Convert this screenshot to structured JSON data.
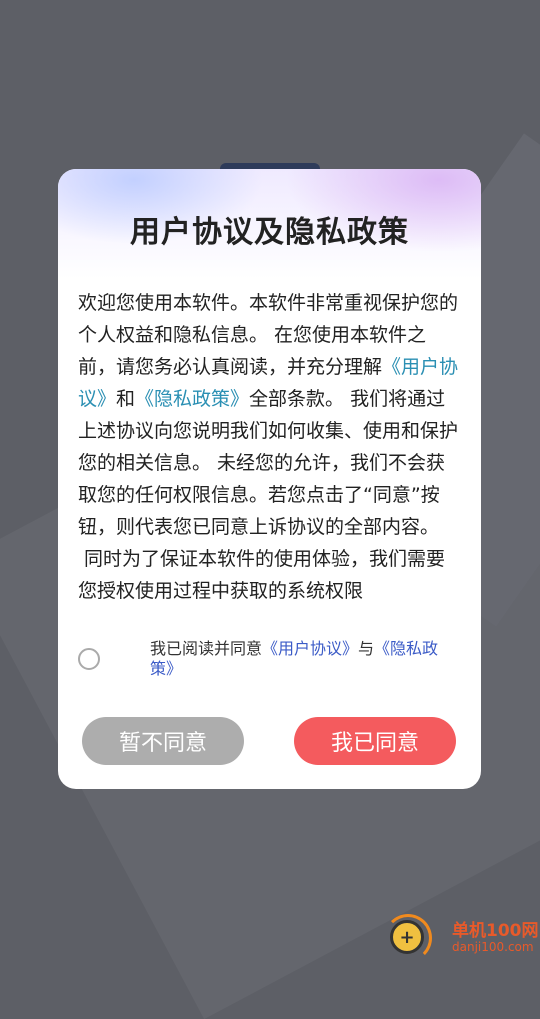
{
  "dialog": {
    "title": "用户协议及隐私政策",
    "body": {
      "p1_prefix": "欢迎您使用本软件。本软件非常重视保护您的个人权益和隐私信息。 在您使用本软件之前，请您务必认真阅读，并充分理解",
      "user_agreement_link": "《用户协议》",
      "and": "和",
      "privacy_link": "《隐私政策》",
      "p1_suffix": "全部条款。 我们将通过上述协议向您说明我们如何收集、使用和保护您的相关信息。 未经您的允许，我们不会获取您的任何权限信息。若您点击了“同意”按钮，则代表您已同意上诉协议的全部内容。",
      "p2": " 同时为了保证本软件的使用体验，我们需要您授权使用过程中获取的系统权限"
    },
    "consent": {
      "checked": false,
      "prefix": "我已阅读并同意",
      "user_agreement_link": "《用户协议》",
      "and": "与",
      "privacy_link": "《隐私政策》"
    },
    "buttons": {
      "disagree": "暂不同意",
      "agree": "我已同意"
    }
  },
  "watermark": {
    "name": "单机100网",
    "domain": "danji100.com"
  },
  "colors": {
    "agree_button": "#f45b5e",
    "disagree_button": "#adadad",
    "link": "#2a8fb3"
  }
}
